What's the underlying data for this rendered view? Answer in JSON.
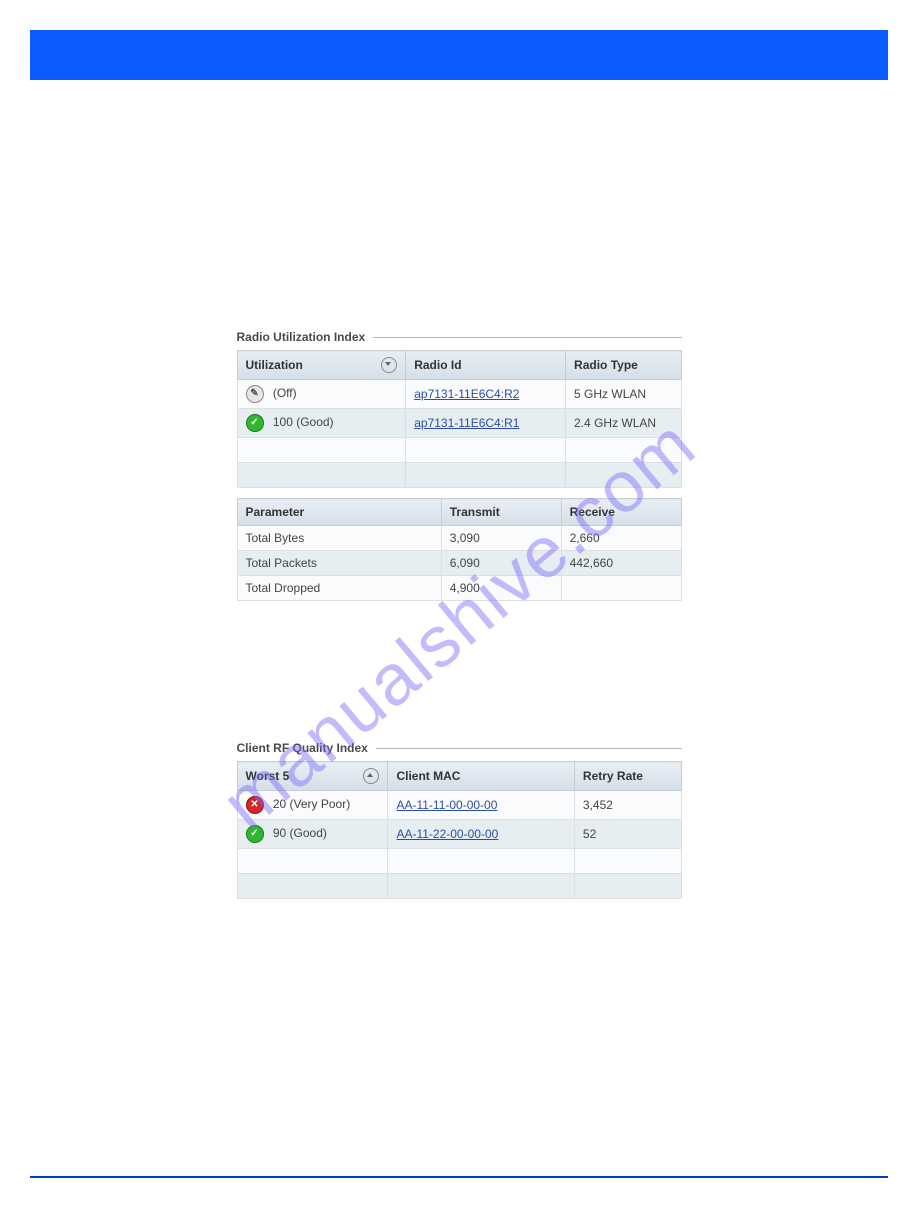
{
  "watermark": "manualshive.com",
  "radio_util": {
    "title": "Radio Utilization Index",
    "headers": {
      "utilization": "Utilization",
      "radio_id": "Radio Id",
      "radio_type": "Radio Type"
    },
    "rows": [
      {
        "status": "off",
        "util_text": "(Off)",
        "radio_id": "ap7131-11E6C4:R2",
        "radio_type": "5 GHz WLAN"
      },
      {
        "status": "good",
        "util_text": "100 (Good)",
        "radio_id": "ap7131-11E6C4:R1",
        "radio_type": "2.4 GHz WLAN"
      }
    ]
  },
  "param_table": {
    "headers": {
      "parameter": "Parameter",
      "transmit": "Transmit",
      "receive": "Receive"
    },
    "rows": [
      {
        "parameter": "Total Bytes",
        "transmit": "3,090",
        "receive": "2,660"
      },
      {
        "parameter": "Total Packets",
        "transmit": "6,090",
        "receive": "442,660"
      },
      {
        "parameter": "Total Dropped",
        "transmit": "4,900",
        "receive": ""
      }
    ]
  },
  "client_rf": {
    "title": "Client RF Quality Index",
    "headers": {
      "worst5": "Worst 5",
      "client_mac": "Client MAC",
      "retry": "Retry Rate"
    },
    "rows": [
      {
        "status": "bad",
        "quality": "20 (Very Poor)",
        "mac": "AA-11-11-00-00-00",
        "retry": "3,452"
      },
      {
        "status": "good",
        "quality": "90 (Good)",
        "mac": "AA-11-22-00-00-00",
        "retry": "52"
      }
    ]
  }
}
